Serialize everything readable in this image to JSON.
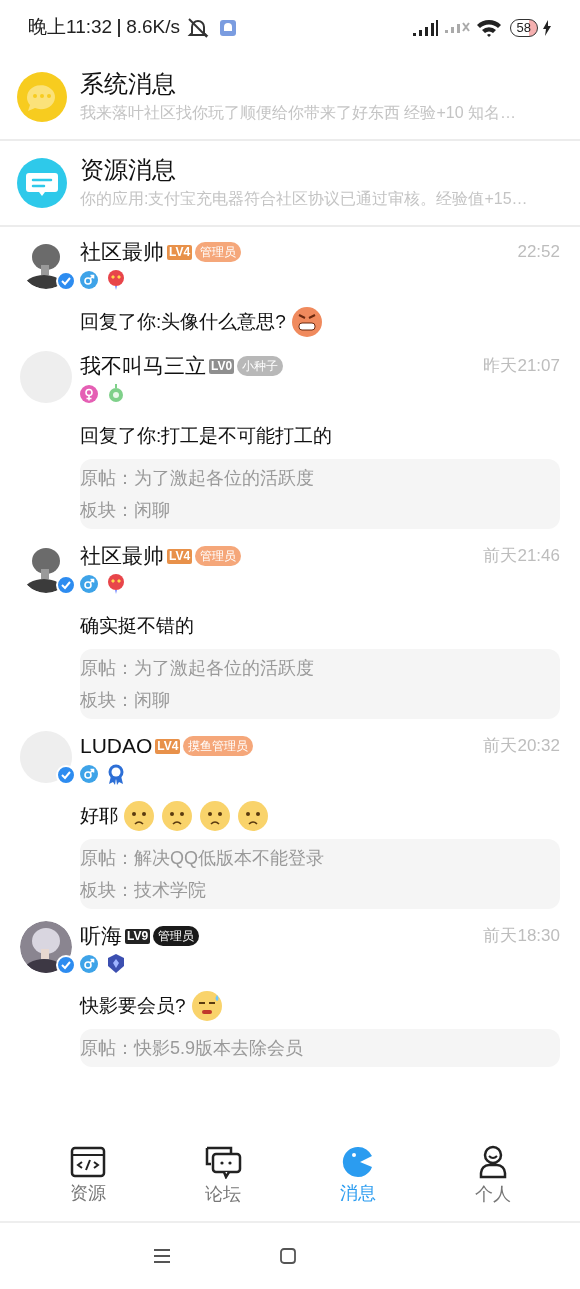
{
  "status_bar": {
    "time": "晚上11:32",
    "speed": "8.6K/s",
    "battery": "58"
  },
  "system_messages": [
    {
      "kind": "system",
      "title": "系统消息",
      "preview": "我来落叶社区找你玩了顺便给你带来了好东西 经验+10 知名…"
    },
    {
      "kind": "resource",
      "title": "资源消息",
      "preview": "你的应用:支付宝充电器符合社区协议已通过审核。经验值+15…"
    }
  ],
  "messages": [
    {
      "avatar": {
        "kind": "picture"
      },
      "verified": true,
      "name": "社区最帅",
      "level": "LV4",
      "role": {
        "label": "管理员",
        "color": "#f5a77a"
      },
      "time": "22:52",
      "gender": {
        "kind": "male"
      },
      "medal": {
        "kind": "heart"
      },
      "text": "回复了你:头像什么意思?",
      "emojis": [
        {
          "kind": "angry"
        }
      ]
    },
    {
      "avatar": {
        "kind": "blank"
      },
      "verified": false,
      "name": "我不叫马三立",
      "level": "LV0",
      "role": {
        "label": "小种子",
        "color": "#b8b8b8"
      },
      "time": "昨天21:07",
      "gender": {
        "kind": "female"
      },
      "medal": {
        "kind": "sprout"
      },
      "text": "回复了你:打工是不可能打工的",
      "quote": {
        "post": "原帖：为了激起各位的活跃度",
        "board": "板块：闲聊"
      }
    },
    {
      "avatar": {
        "kind": "picture"
      },
      "verified": true,
      "name": "社区最帅",
      "level": "LV4",
      "role": {
        "label": "管理员",
        "color": "#f5a77a"
      },
      "time": "前天21:46",
      "gender": {
        "kind": "male"
      },
      "medal": {
        "kind": "heart"
      },
      "text": "确实挺不错的",
      "quote": {
        "post": "原帖：为了激起各位的活跃度",
        "board": "板块：闲聊"
      }
    },
    {
      "avatar": {
        "kind": "blank"
      },
      "verified": true,
      "name": "LUDAO",
      "level": "LV4",
      "role": {
        "label": "摸鱼管理员",
        "color": "#f5a77a"
      },
      "time": "前天20:32",
      "gender": {
        "kind": "male"
      },
      "medal": {
        "kind": "ribbon"
      },
      "text": "好耶",
      "emojis": [
        {
          "kind": "worried"
        },
        {
          "kind": "worried"
        },
        {
          "kind": "worried"
        },
        {
          "kind": "worried"
        }
      ],
      "quote": {
        "post": "原帖：解决QQ低版本不能登录",
        "board": "板块：技术学院"
      }
    },
    {
      "avatar": {
        "kind": "picture"
      },
      "verified": true,
      "name": "听海",
      "level": "LV9",
      "role": {
        "label": "管理员",
        "color": "#1a1a1a"
      },
      "time": "前天18:30",
      "gender": {
        "kind": "male"
      },
      "medal": {
        "kind": "shield"
      },
      "text": "快影要会员?",
      "emojis": [
        {
          "kind": "sweat"
        }
      ],
      "quote": {
        "post": "原帖：快影5.9版本去除会员"
      }
    }
  ],
  "tabs": [
    {
      "label": "资源",
      "kind": "code",
      "selected": false
    },
    {
      "label": "论坛",
      "kind": "chat",
      "selected": false
    },
    {
      "label": "消息",
      "kind": "message",
      "selected": true
    },
    {
      "label": "个人",
      "kind": "person",
      "selected": false
    }
  ]
}
